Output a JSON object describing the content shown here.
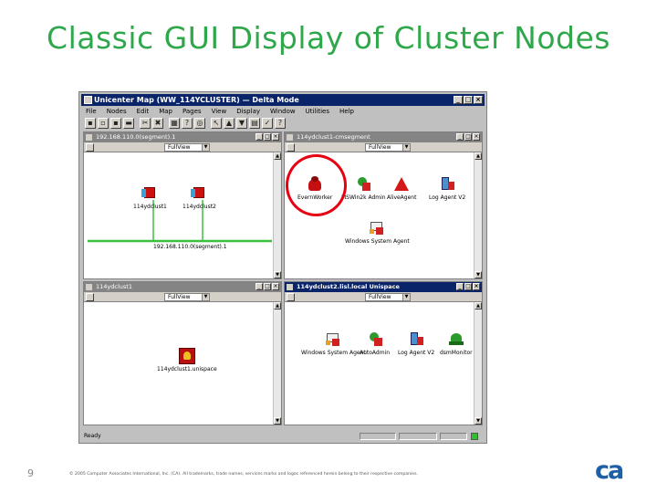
{
  "slide": {
    "title": "Classic GUI Display of Cluster Nodes",
    "page_number": "9",
    "copyright": "© 2005 Computer Associates International, Inc. (CA). All trademarks, trade names, services marks and logos referenced herein belong to their respective companies.",
    "logo": "ca"
  },
  "app": {
    "title": "Unicenter Map (WW_114YCLUSTER) — Delta Mode",
    "menus": [
      "File",
      "Nodes",
      "Edit",
      "Map",
      "Pages",
      "View",
      "Display",
      "Window",
      "Utilities",
      "Help"
    ],
    "status_text": "Ready"
  },
  "windows": {
    "tl": {
      "title": "192.168.110.0(segment).1",
      "view": "FullView",
      "nodes": [
        "114ydclust1",
        "114ydclust2"
      ],
      "segment_label": "192.168.110.0(segment).1"
    },
    "tr": {
      "title": "114ydclust1-cmsegment",
      "view": "FullView",
      "nodes": [
        "EvernWorker",
        "MSWin2k Admin",
        "AliveAgent",
        "Log Agent V2",
        "Windows System Agent"
      ]
    },
    "bl": {
      "title": "114ydclust1",
      "view": "FullView",
      "nodes": [
        "114ydclust1.unispace"
      ]
    },
    "br": {
      "title": "114ydclust2.lisl.local Unispace",
      "view": "FullView",
      "nodes": [
        "Windows System Agent",
        "AutoAdmin",
        "Log Agent V2",
        "dsmMonitor"
      ]
    }
  },
  "colors": {
    "title_green": "#2ea84a",
    "highlight_red": "#e60012",
    "active_title": "#0a246a",
    "inactive_title": "#848484",
    "logo_blue": "#1d5fa8"
  }
}
